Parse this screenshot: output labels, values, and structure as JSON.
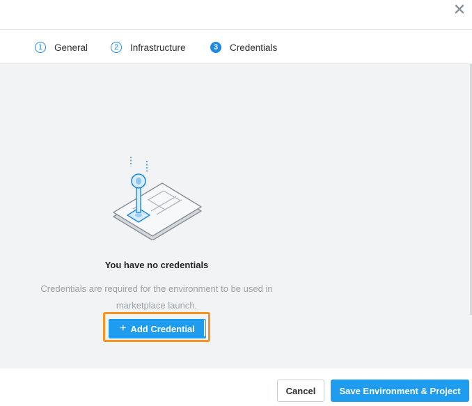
{
  "dialog": {
    "close_icon": "close-icon"
  },
  "steps": [
    {
      "number": "1",
      "label": "General",
      "state": "complete"
    },
    {
      "number": "2",
      "label": "Infrastructure",
      "state": "complete"
    },
    {
      "number": "3",
      "label": "Credentials",
      "state": "active"
    }
  ],
  "empty_state": {
    "illustration": "key-card-illustration",
    "title": "You have no credentials",
    "description": "Credentials are required for the environment to be used in marketplace launch.",
    "add_button_label": "Add Credential",
    "add_button_icon": "plus-icon"
  },
  "footer": {
    "cancel_label": "Cancel",
    "save_label": "Save Environment & Project"
  },
  "colors": {
    "accent": "#1e9cf0",
    "highlight": "#f7931e",
    "panel_bg": "#f2f3f4"
  }
}
